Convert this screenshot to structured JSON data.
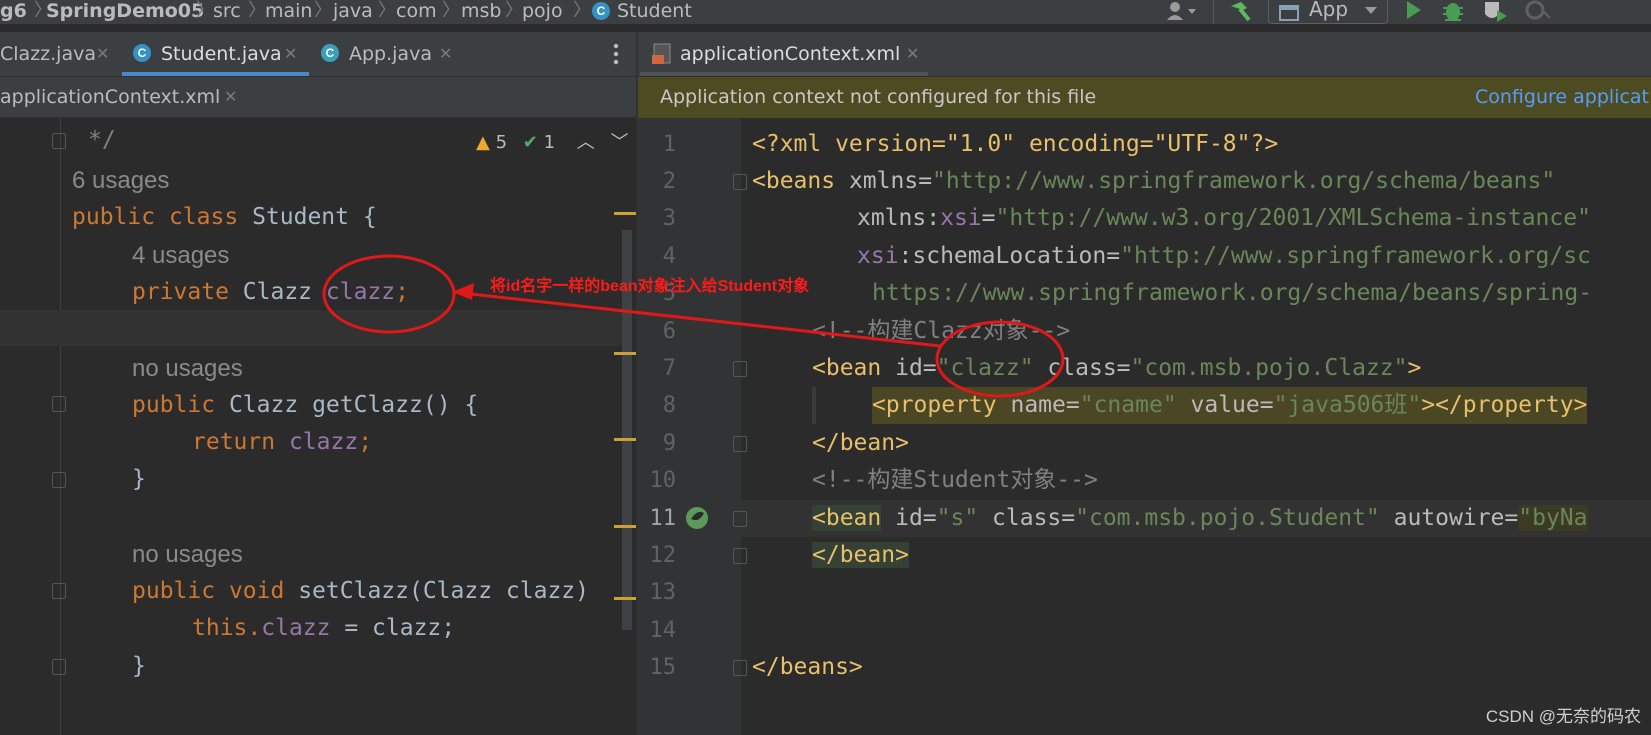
{
  "breadcrumb": {
    "items": [
      "g6",
      "SpringDemo05",
      "src",
      "main",
      "java",
      "com",
      "msb",
      "pojo",
      "Student"
    ]
  },
  "toolbar": {
    "run_config": "App"
  },
  "tabs_left": {
    "clazz": "Clazz.java",
    "student": "Student.java",
    "app": "App.java",
    "context": "applicationContext.xml"
  },
  "tabs_right": {
    "context": "applicationContext.xml"
  },
  "banner": {
    "message": "Application context not configured for this file",
    "link": "Configure applicat"
  },
  "inspection": {
    "warnings": "5",
    "checks": "1"
  },
  "java_code": {
    "line0": "*/",
    "usages6": "6 usages",
    "public": "public",
    "class": "class",
    "student": "Student",
    "brace_open": "{",
    "usages4": "4 usages",
    "private": "private",
    "clazz_type": "Clazz",
    "clazz_field": "clazz",
    "semi": ";",
    "no_usages": "no usages",
    "getter_name": "getClazz",
    "paren_brace": "() {",
    "return": "return",
    "brace_close": "}",
    "void": "void",
    "setter_name": "setClazz",
    "setter_params": "(Clazz clazz)",
    "this": "this.",
    "assign": " = clazz;"
  },
  "xml_lines": [
    "1",
    "2",
    "3",
    "4",
    "5",
    "6",
    "7",
    "8",
    "9",
    "10",
    "11",
    "12",
    "13",
    "14",
    "15"
  ],
  "xml": {
    "l1": "<?xml version=\"1.0\" encoding=\"UTF-8\"?>",
    "l2a": "<beans ",
    "l2b": "xmlns",
    "l2c": "=",
    "l2d": "\"http://www.springframework.org/schema/beans\"",
    "l3a": "xmlns:",
    "l3b": "xsi",
    "l3c": "=",
    "l3d": "\"http://www.w3.org/2001/XMLSchema-instance\"",
    "l4a": "xsi",
    "l4b": ":schemaLocation=",
    "l4c": "\"http://www.springframework.org/sc",
    "l5": "https://www.springframework.org/schema/beans/spring-",
    "l6": "<!--构建Clazz对象-->",
    "l7a": "<bean ",
    "l7b": "id=",
    "l7c": "\"clazz\"",
    "l7d": " class=",
    "l7e": "\"com.msb.pojo.Clazz\"",
    "l7f": ">",
    "l8a": "<property ",
    "l8b": "name=",
    "l8c": "\"cname\"",
    "l8d": " value=",
    "l8e": "\"java506班\"",
    "l8f": "></property>",
    "l9": "</bean>",
    "l10": "<!--构建Student对象-->",
    "l11a": "<bean",
    "l11b": " id=",
    "l11c": "\"s\"",
    "l11d": " class=",
    "l11e": "\"com.msb.pojo.Student\"",
    "l11f": " autowire=",
    "l11g": "\"byNa",
    "l12": "</bean>",
    "l15": "</beans>"
  },
  "annotation": {
    "text": "将id名字一样的bean对象注入给Student对象"
  },
  "watermark": "CSDN @无奈的码农",
  "colors": {
    "accent": "#4a88c7",
    "annotation": "#ff1a1a",
    "banner": "#4d4b21"
  }
}
